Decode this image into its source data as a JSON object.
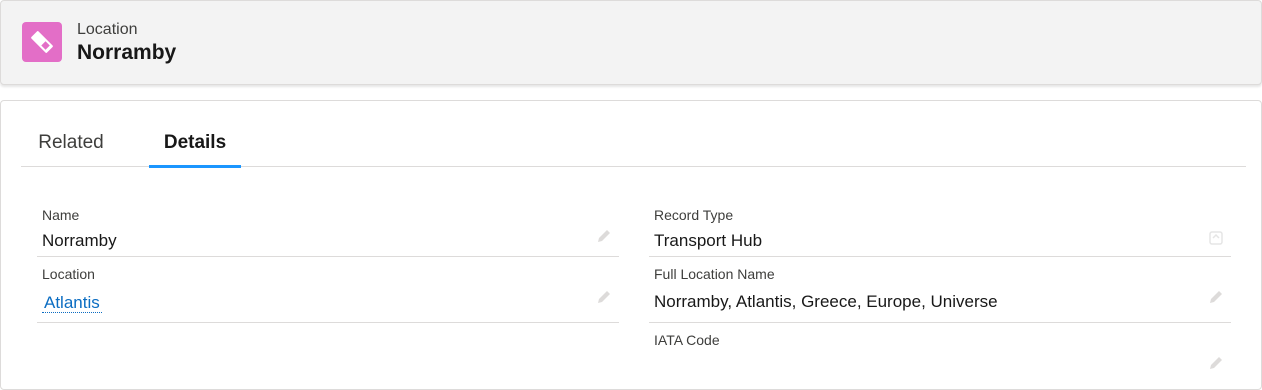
{
  "header": {
    "object_label": "Location",
    "record_name": "Norramby",
    "icon": "location-pin-icon",
    "icon_color": "#e36ec7"
  },
  "tabs": [
    {
      "label": "Related",
      "active": false
    },
    {
      "label": "Details",
      "active": true
    }
  ],
  "colors": {
    "accent": "#1b96ff",
    "link": "#0b6dc2",
    "border": "#dddbda"
  },
  "fields": {
    "name": {
      "label": "Name",
      "value": "Norramby"
    },
    "location": {
      "label": "Location",
      "value": "Atlantis"
    },
    "record_type": {
      "label": "Record Type",
      "value": "Transport Hub"
    },
    "full_location_name": {
      "label": "Full Location Name",
      "value": "Norramby, Atlantis, Greece, Europe, Universe"
    },
    "iata_code": {
      "label": "IATA Code",
      "value": ""
    }
  }
}
